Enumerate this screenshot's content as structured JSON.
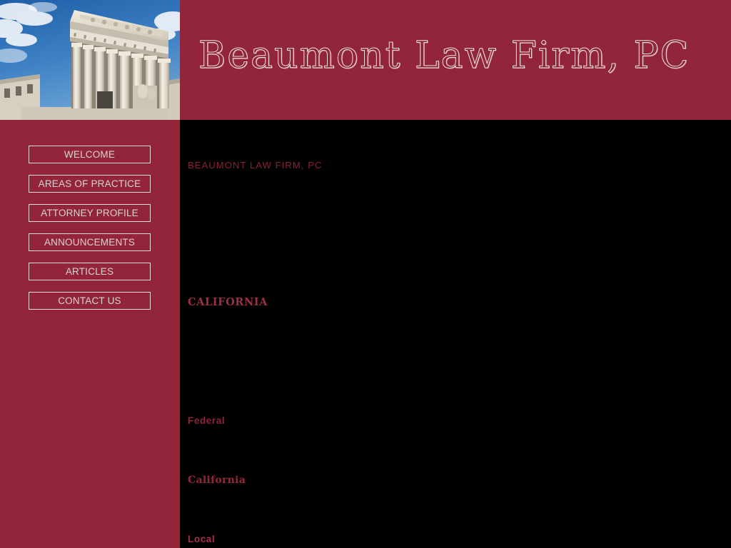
{
  "site": {
    "title": "Beaumont Law Firm, PC",
    "banner_image_alt": "courthouse-facade-with-columns",
    "colors": {
      "brand_maroon": "#92253A",
      "content_background": "#000000",
      "heading_red": "#8B2134",
      "heading_red_bright": "#A33148",
      "button_border": "#EBDADA",
      "button_text": "#D9D2D2",
      "sky_blue": "#3E7FC1",
      "stone": "#E4DED2"
    }
  },
  "sidebar": {
    "items": [
      {
        "label": "WELCOME"
      },
      {
        "label": "AREAS OF PRACTICE"
      },
      {
        "label": "ATTORNEY PROFILE"
      },
      {
        "label": "ANNOUNCEMENTS"
      },
      {
        "label": "ARTICLES"
      },
      {
        "label": "CONTACT US"
      }
    ]
  },
  "main": {
    "firm_heading": "BEAUMONT LAW FIRM, PC",
    "firm_body": "",
    "state_heading": "CALIFORNIA",
    "state_body": "",
    "subsections": [
      {
        "heading": "Federal",
        "body": ""
      },
      {
        "heading": "California",
        "body": ""
      },
      {
        "heading": "Local",
        "body": ""
      }
    ]
  }
}
